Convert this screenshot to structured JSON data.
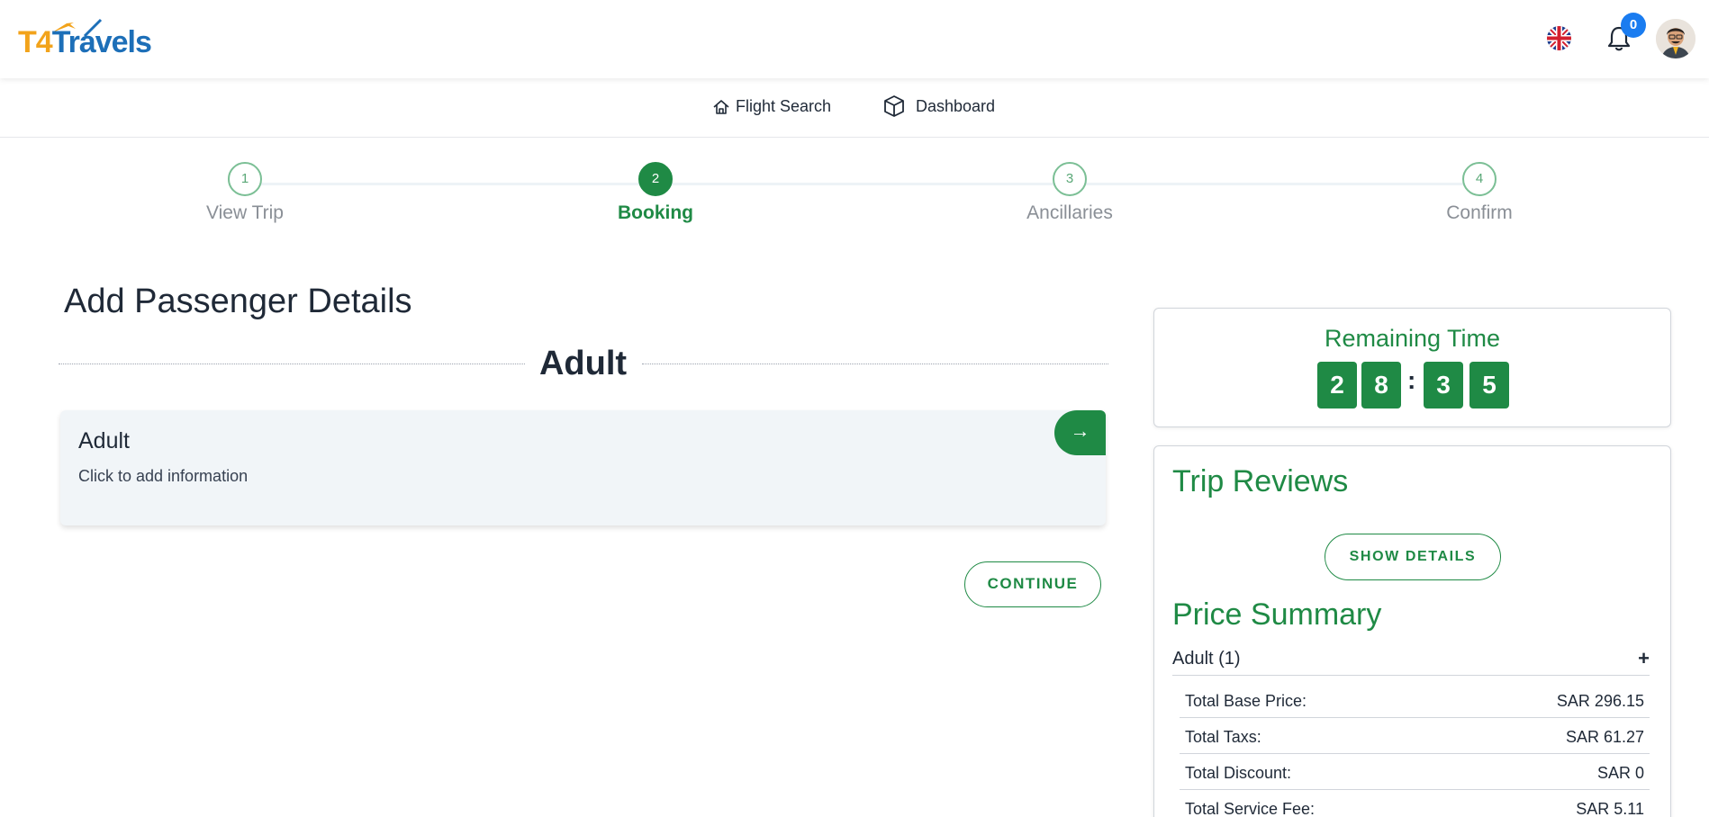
{
  "brand": {
    "logo_t4": "T4",
    "logo_travels": "Travels"
  },
  "header": {
    "notification_count": "0",
    "language_flag": "uk-flag-icon"
  },
  "nav": {
    "flight_search": "Flight Search",
    "dashboard": "Dashboard"
  },
  "stepper": {
    "steps": [
      {
        "number": "1",
        "label": "View Trip",
        "state": "done"
      },
      {
        "number": "2",
        "label": "Booking",
        "state": "active"
      },
      {
        "number": "3",
        "label": "Ancillaries",
        "state": "pending"
      },
      {
        "number": "4",
        "label": "Confirm",
        "state": "pending"
      }
    ]
  },
  "main": {
    "title": "Add Passenger Details",
    "section_heading": "Adult",
    "passenger_card": {
      "title": "Adult",
      "subtitle": "Click to add information",
      "arrow": "→"
    },
    "continue_label": "CONTINUE"
  },
  "timer": {
    "title": "Remaining Time",
    "digits": [
      "2",
      "8",
      "3",
      "5"
    ],
    "separator": ":"
  },
  "trip_reviews": {
    "title": "Trip Reviews",
    "show_details_label": "SHOW DETAILS",
    "price_summary_title": "Price Summary",
    "adult_group_label": "Adult (1)",
    "expand_symbol": "+",
    "rows": [
      {
        "label": "Total Base Price:",
        "value": "SAR 296.15"
      },
      {
        "label": "Total Taxs:",
        "value": "SAR 61.27"
      },
      {
        "label": "Total Discount:",
        "value": "SAR 0"
      },
      {
        "label": "Total Service Fee:",
        "value": "SAR 5.11"
      }
    ]
  },
  "colors": {
    "brand_green": "#1f8a45",
    "badge_blue": "#1a7cf0",
    "logo_orange": "#f2a31b",
    "logo_blue": "#1d6fb8"
  }
}
